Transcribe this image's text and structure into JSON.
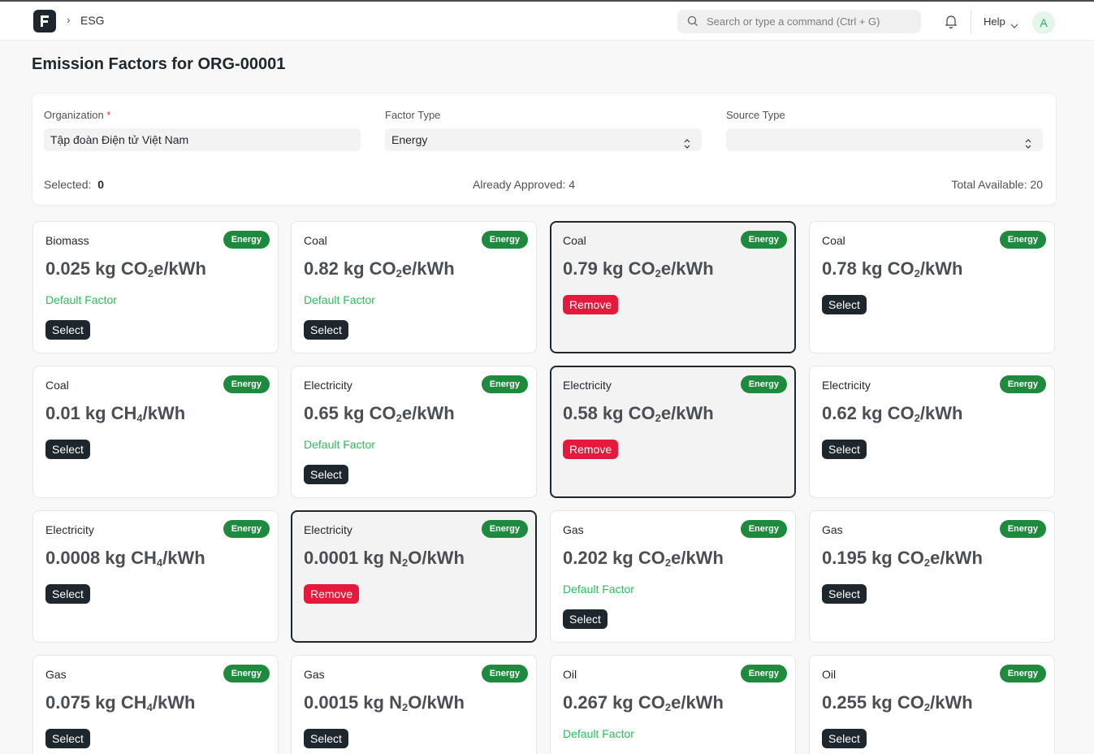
{
  "header": {
    "breadcrumb_sep": "›",
    "breadcrumb": "ESG",
    "search_placeholder": "Search or type a command (Ctrl + G)",
    "help_label": "Help",
    "avatar_letter": "A"
  },
  "page": {
    "title": "Emission Factors for ORG-00001"
  },
  "filters": {
    "organization_label": "Organization",
    "required_mark": "*",
    "organization_value": "Tập đoàn Điện tử Việt Nam",
    "factor_type_label": "Factor Type",
    "factor_type_value": "Energy",
    "source_type_label": "Source Type",
    "source_type_value": ""
  },
  "stats": {
    "selected_label": "Selected:",
    "selected_value": "0",
    "approved": "Already Approved: 4",
    "total": "Total Available: 20"
  },
  "cards": [
    {
      "title": "Biomass",
      "badge": "Energy",
      "value": "0.025",
      "unit_pre": "kg CO",
      "sub": "2",
      "unit_post": "e/kWh",
      "default": "Default Factor",
      "action": "Select",
      "selected": false
    },
    {
      "title": "Coal",
      "badge": "Energy",
      "value": "0.82",
      "unit_pre": "kg CO",
      "sub": "2",
      "unit_post": "e/kWh",
      "default": "Default Factor",
      "action": "Select",
      "selected": false
    },
    {
      "title": "Coal",
      "badge": "Energy",
      "value": "0.79",
      "unit_pre": "kg CO",
      "sub": "2",
      "unit_post": "e/kWh",
      "default": "",
      "action": "Remove",
      "selected": true
    },
    {
      "title": "Coal",
      "badge": "Energy",
      "value": "0.78",
      "unit_pre": "kg CO",
      "sub": "2",
      "unit_post": "/kWh",
      "default": "",
      "action": "Select",
      "selected": false
    },
    {
      "title": "Coal",
      "badge": "Energy",
      "value": "0.01",
      "unit_pre": "kg CH",
      "sub": "4",
      "unit_post": "/kWh",
      "default": "",
      "action": "Select",
      "selected": false
    },
    {
      "title": "Electricity",
      "badge": "Energy",
      "value": "0.65",
      "unit_pre": "kg CO",
      "sub": "2",
      "unit_post": "e/kWh",
      "default": "Default Factor",
      "action": "Select",
      "selected": false
    },
    {
      "title": "Electricity",
      "badge": "Energy",
      "value": "0.58",
      "unit_pre": "kg CO",
      "sub": "2",
      "unit_post": "e/kWh",
      "default": "",
      "action": "Remove",
      "selected": true
    },
    {
      "title": "Electricity",
      "badge": "Energy",
      "value": "0.62",
      "unit_pre": "kg CO",
      "sub": "2",
      "unit_post": "/kWh",
      "default": "",
      "action": "Select",
      "selected": false
    },
    {
      "title": "Electricity",
      "badge": "Energy",
      "value": "0.0008",
      "unit_pre": "kg CH",
      "sub": "4",
      "unit_post": "/kWh",
      "default": "",
      "action": "Select",
      "selected": false
    },
    {
      "title": "Electricity",
      "badge": "Energy",
      "value": "0.0001",
      "unit_pre": "kg N",
      "sub": "2",
      "unit_post": "O/kWh",
      "default": "",
      "action": "Remove",
      "selected": true
    },
    {
      "title": "Gas",
      "badge": "Energy",
      "value": "0.202",
      "unit_pre": "kg CO",
      "sub": "2",
      "unit_post": "e/kWh",
      "default": "Default Factor",
      "action": "Select",
      "selected": false
    },
    {
      "title": "Gas",
      "badge": "Energy",
      "value": "0.195",
      "unit_pre": "kg CO",
      "sub": "2",
      "unit_post": "e/kWh",
      "default": "",
      "action": "Select",
      "selected": false
    },
    {
      "title": "Gas",
      "badge": "Energy",
      "value": "0.075",
      "unit_pre": "kg CH",
      "sub": "4",
      "unit_post": "/kWh",
      "default": "",
      "action": "Select",
      "selected": false
    },
    {
      "title": "Gas",
      "badge": "Energy",
      "value": "0.0015",
      "unit_pre": "kg N",
      "sub": "2",
      "unit_post": "O/kWh",
      "default": "",
      "action": "Select",
      "selected": false
    },
    {
      "title": "Oil",
      "badge": "Energy",
      "value": "0.267",
      "unit_pre": "kg CO",
      "sub": "2",
      "unit_post": "e/kWh",
      "default": "Default Factor",
      "action": "Select",
      "selected": false
    },
    {
      "title": "Oil",
      "badge": "Energy",
      "value": "0.255",
      "unit_pre": "kg CO",
      "sub": "2",
      "unit_post": "/kWh",
      "default": "",
      "action": "Select",
      "selected": false
    }
  ]
}
